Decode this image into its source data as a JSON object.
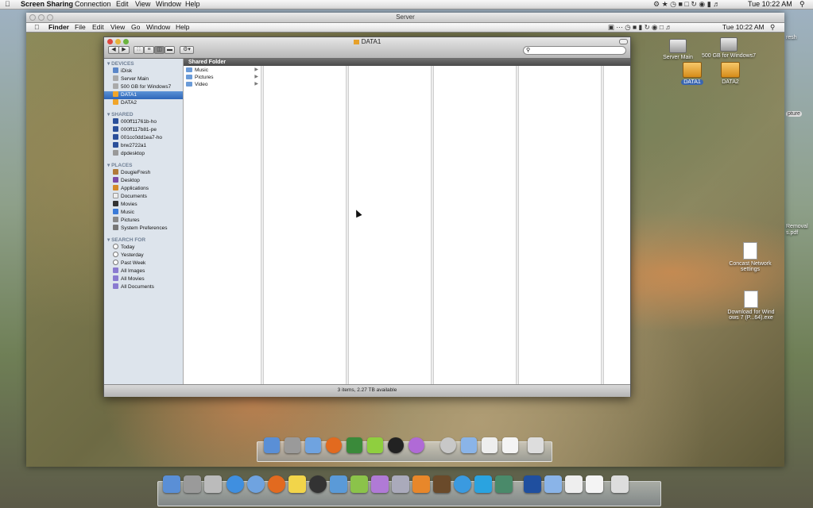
{
  "host_menubar": {
    "app": "Screen Sharing",
    "menus": [
      "Connection",
      "Edit",
      "View",
      "Window",
      "Help"
    ],
    "clock": "Tue 10:22 AM"
  },
  "remote": {
    "window_title": "Server",
    "menubar": {
      "app": "Finder",
      "menus": [
        "File",
        "Edit",
        "View",
        "Go",
        "Window",
        "Help"
      ],
      "clock": "Tue 10:22 AM"
    }
  },
  "finder": {
    "title": "DATA1",
    "search_placeholder": "",
    "sidebar": {
      "devices_header": "DEVICES",
      "devices": [
        "iDisk",
        "Server Main",
        "500 GB for Windows7",
        "DATA1",
        "DATA2"
      ],
      "shared_header": "SHARED",
      "shared": [
        "000ff11761b-ho",
        "000ff117b81-pe",
        "001cc0dd1ea7-ho",
        "brw2722a1",
        "dpdesktop"
      ],
      "places_header": "PLACES",
      "places": [
        "DougieFresh",
        "Desktop",
        "Applications",
        "Documents",
        "Movies",
        "Music",
        "Pictures",
        "System Preferences"
      ],
      "search_header": "SEARCH FOR",
      "search_for": [
        "Today",
        "Yesterday",
        "Past Week",
        "All Images",
        "All Movies",
        "All Documents"
      ]
    },
    "column_header": "Shared Folder",
    "items": [
      "Music",
      "Pictures",
      "Video"
    ],
    "status": "3 items, 2.27 TB available"
  },
  "desktop_icons": {
    "server_main": "Server Main",
    "windows7": "500 GB for Windows7",
    "data1": "DATA1",
    "data2": "DATA2",
    "concast": "Concast Network settings",
    "download": "Download for Wind ows 7 (P...64).exe"
  },
  "host_desktop": {
    "fresh": "resh",
    "capture": "pture",
    "removal": "Removal",
    "pdf": "s.pdf"
  },
  "colors": {
    "selection": "#2e66b8",
    "sidebar_bg": "#dde4ec",
    "column_header_bg": "#4a4a4a"
  }
}
